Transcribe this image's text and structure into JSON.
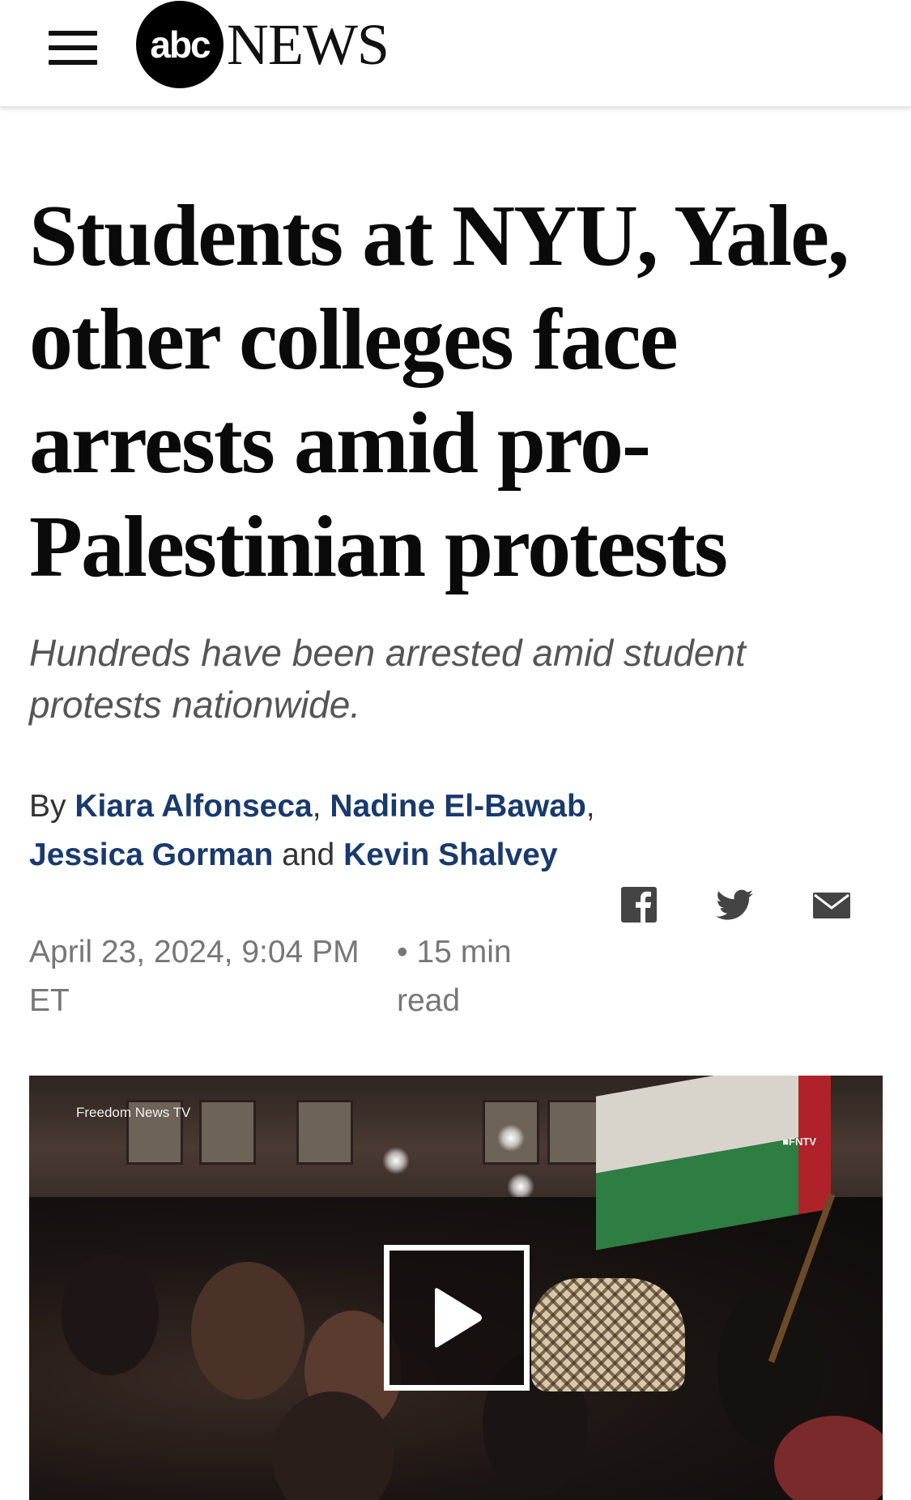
{
  "header": {
    "logo_abc": "abc",
    "logo_news": "NEWS"
  },
  "article": {
    "headline": "Students at NYU, Yale, other colleges face arrests amid pro-Palestinian protests",
    "subhead": "Hundreds have been arrested amid student protests nationwide.",
    "byline": {
      "prefix": "By",
      "authors": [
        "Kiara Alfonseca",
        "Nadine El-Bawab",
        "Jessica Gorman",
        "Kevin Shalvey"
      ],
      "sep1": ", ",
      "sep2": ", ",
      "conj": " and "
    },
    "date": "April 23, 2024, 9:04 PM ET",
    "read_time": "• 15 min read"
  },
  "share": {
    "icons": [
      "facebook-icon",
      "twitter-icon",
      "email-icon"
    ],
    "color": "#444444"
  },
  "video": {
    "watermark_left": "Freedom News TV",
    "watermark_right": "■FNTV",
    "play_icon": "play-icon"
  },
  "colors": {
    "link": "#1a3a6e",
    "meta": "#777777",
    "subhead": "#555555"
  }
}
